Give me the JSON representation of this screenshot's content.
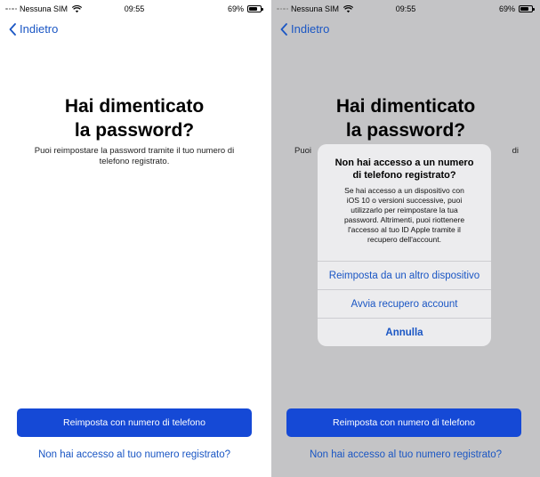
{
  "left_screen": {
    "status": {
      "carrier": "Nessuna SIM",
      "time": "09:55",
      "battery": "69%"
    },
    "back_label": "Indietro",
    "title_line1": "Hai dimenticato",
    "title_line2": "la password?",
    "subtitle_line1": "Puoi reimpostare la password tramite il tuo numero di",
    "subtitle_line2": "telefono registrato.",
    "primary_button": "Reimposta con numero di telefono",
    "link": "Non hai accesso al tuo numero registrato?"
  },
  "right_screen": {
    "status": {
      "carrier": "Nessuna SIM",
      "time": "09:55",
      "battery": "69%"
    },
    "back_label": "Indietro",
    "title_line1": "Hai dimenticato",
    "title_line2": "la password?",
    "subtitle_left": "Puoi",
    "subtitle_right": "di",
    "primary_button": "Reimposta con numero di telefono",
    "link": "Non hai accesso al tuo numero registrato?",
    "alert": {
      "title_line1": "Non hai accesso a un numero",
      "title_line2": "di telefono registrato?",
      "message_lines": [
        "Se hai accesso a un dispositivo con",
        "iOS 10 o versioni successive, puoi",
        "utilizzarlo per reimpostare la tua",
        "password. Altrimenti, puoi riottenere",
        "l'accesso al tuo ID Apple tramite il",
        "recupero dell'account."
      ],
      "actions": [
        "Reimposta da un altro dispositivo",
        "Avvia recupero account",
        "Annulla"
      ]
    }
  },
  "colors": {
    "accent": "#1a56c4",
    "button_fill": "#1549d6",
    "dim_background": "#c4c4c6",
    "alert_background": "#ececee"
  },
  "icons": [
    "signal-dots-icon",
    "wifi-icon",
    "battery-icon",
    "chevron-left-icon"
  ]
}
